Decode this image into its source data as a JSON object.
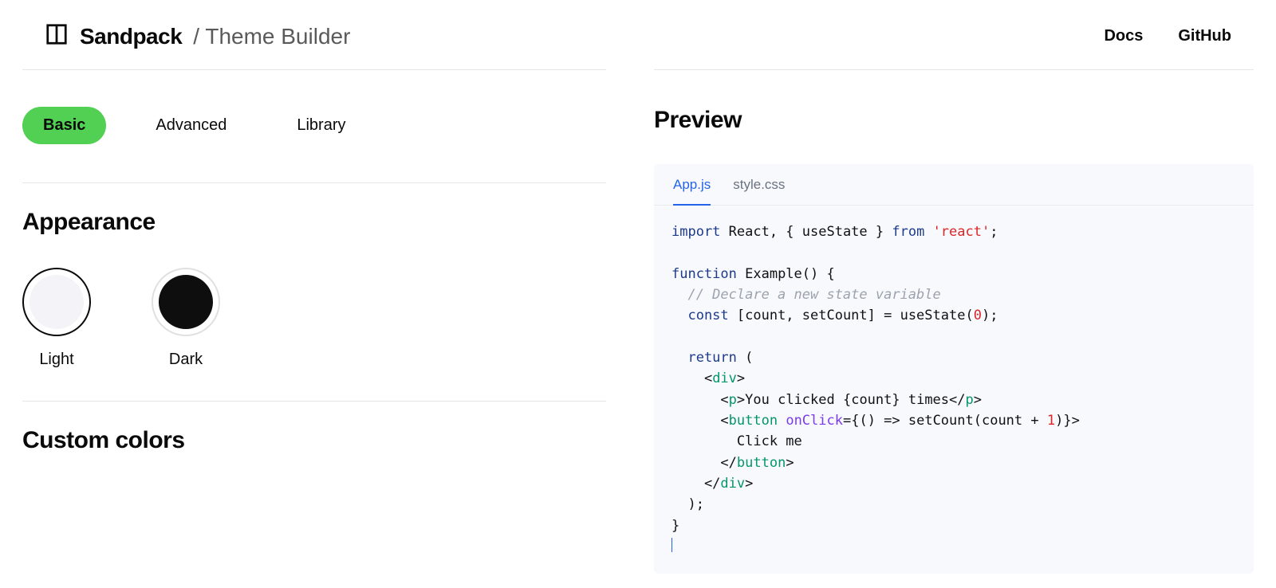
{
  "header": {
    "brand": "Sandpack",
    "subtitle": "/ Theme Builder",
    "nav": {
      "docs": "Docs",
      "github": "GitHub"
    }
  },
  "tabs": {
    "basic": "Basic",
    "advanced": "Advanced",
    "library": "Library",
    "active": "basic"
  },
  "sections": {
    "appearance": "Appearance",
    "custom_colors": "Custom colors"
  },
  "appearance": {
    "light": {
      "label": "Light",
      "swatch": "#f4f4f8",
      "selected": true
    },
    "dark": {
      "label": "Dark",
      "swatch": "#0e0e0e",
      "selected": false
    }
  },
  "preview": {
    "title": "Preview",
    "file_tabs": {
      "app": "App.js",
      "style": "style.css",
      "active": "app"
    },
    "code": {
      "l1_import": "import",
      "l1_react": " React, { useState } ",
      "l1_from": "from",
      "l1_str": "'react'",
      "l1_semi": ";",
      "l3_fn": "function",
      "l3_name": " Example() {",
      "l4_cmt": "  // Declare a new state variable",
      "l5_const": "  const",
      "l5_rest": " [count, setCount] = useState(",
      "l5_zero": "0",
      "l5_close": ");",
      "l7_return": "  return",
      "l7_paren": " (",
      "l8_open": "    <",
      "l8_div": "div",
      "l8_gt": ">",
      "l9_open": "      <",
      "l9_p": "p",
      "l9_gt": ">",
      "l9_txt": "You clicked {count} times",
      "l9_close_open": "</",
      "l9_p2": "p",
      "l9_close_gt": ">",
      "l10_open": "      <",
      "l10_btn": "button",
      "l10_sp": " ",
      "l10_attr": "onClick",
      "l10_eq": "={() => setCount(count + ",
      "l10_one": "1",
      "l10_end": ")}>",
      "l11_txt": "        Click me",
      "l12_open": "      </",
      "l12_btn": "button",
      "l12_gt": ">",
      "l13_open": "    </",
      "l13_div": "div",
      "l13_gt": ">",
      "l14": "  );",
      "l15": "}"
    }
  }
}
